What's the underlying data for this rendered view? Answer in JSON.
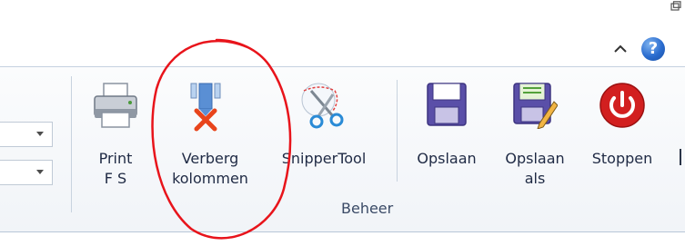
{
  "toolbar": {
    "help_glyph": "?",
    "buttons": [
      {
        "label": "Print\nF S",
        "icon": "printer-icon"
      },
      {
        "label": "Verberg\nkolommen",
        "icon": "hide-columns-icon"
      },
      {
        "label": "SnipperTool",
        "icon": "scissors-icon"
      },
      {
        "label": "Opslaan",
        "icon": "save-icon"
      },
      {
        "label": "Opslaan\nals",
        "icon": "save-as-icon"
      },
      {
        "label": "Stoppen",
        "icon": "power-icon"
      }
    ],
    "group_label": "Beheer"
  },
  "colors": {
    "accent_blue": "#2a6ccf",
    "annotation_red": "#e8141b",
    "stop_red": "#d21f1f",
    "save_purple": "#5a4fa8"
  }
}
